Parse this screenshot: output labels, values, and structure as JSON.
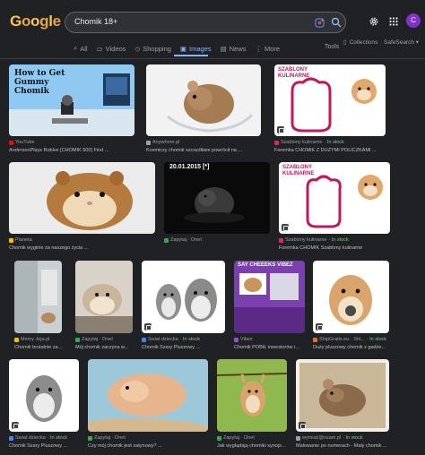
{
  "header": {
    "logo_letters": [
      "G",
      "o",
      "o",
      "g",
      "l",
      "e"
    ],
    "logo_colors": [
      "#f2c94c",
      "#e8a33d",
      "#f2c94c",
      "#e8a33d",
      "#f2c94c",
      "#e8a33d"
    ],
    "search_value": "Chomik 18+",
    "avatar_letter": "C"
  },
  "tabs": {
    "all": "All",
    "videos": "Videos",
    "shopping": "Shopping",
    "images": "Images",
    "news": "News",
    "more": "More",
    "tools": "Tools",
    "collections": "Collections",
    "safesearch": "SafeSearch ▾"
  },
  "colors": {
    "accent": "#8ab4f8",
    "in_stock": "#81c995",
    "background": "#202124"
  },
  "results": [
    {
      "source": "YouTube",
      "in_stock": "",
      "caption": "AndersonPlays Roblox [CHOMIK 500] Find ...",
      "overlay": "How to Get Gummy Chomik",
      "fav": "#ff0000"
    },
    {
      "source": "Anywhere.pl",
      "in_stock": "",
      "caption": "Kosmiczy chomik szczęśliwie powrócił na ...",
      "overlay": "",
      "fav": "#9aa0a6"
    },
    {
      "source": "Szablony kulinarne",
      "in_stock": "· In stock",
      "caption": "Foremka CHOMIK Z DUŻYMI POLICZKAMI ...",
      "overlay": "SZABLONY KULINARNE",
      "fav": "#e91e63"
    },
    {
      "source": "Planeta",
      "in_stock": "",
      "caption": "Chomik wyginie za naszego życia ...",
      "overlay": "",
      "fav": "#fbbc04"
    },
    {
      "source": "Zapytaj · Onet",
      "in_stock": "",
      "caption": "",
      "overlay": "20.01.2015 [*]",
      "fav": "#34a853"
    },
    {
      "source": "Szablony kulinarne",
      "in_stock": "· In stock",
      "caption": "Foremka CHOMIK Szablony kulinarne",
      "overlay": "SZABLONY KULINARNE",
      "fav": "#e91e63"
    },
    {
      "source": "Memy Jeja.pl",
      "in_stock": "",
      "caption": "Chomik brutalnie zamo...",
      "overlay": "",
      "fav": "#fbbc04"
    },
    {
      "source": "Zapytaj · Onet",
      "in_stock": "",
      "caption": "Mój chomik zaczyna w...",
      "overlay": "",
      "fav": "#34a853"
    },
    {
      "source": "Świat dziecka",
      "in_stock": "· In stock",
      "caption": "Chomik Szary Pluszowy ...",
      "overlay": "",
      "fav": "#4285f4"
    },
    {
      "source": "Vibez",
      "in_stock": "",
      "caption": "Chomik POBIŁ inwestorów i...",
      "overlay": "SAY CHEEEKS VIBEZ",
      "fav": "#a142f4"
    },
    {
      "source": "ShipGratis.eu · Shi...",
      "in_stock": "· In stock",
      "caption": "Duży pluszowy chomik z gadże...",
      "overlay": "",
      "fav": "#ff6d00"
    },
    {
      "source": "Świat dziecka",
      "in_stock": "· In stock",
      "caption": "Chomik Szary Pluszowy ...",
      "overlay": "",
      "fav": "#4285f4"
    },
    {
      "source": "Zapytaj · Onet",
      "in_stock": "",
      "caption": "Czy mój chomik jest zatynowy? ...",
      "overlay": "",
      "fav": "#34a853"
    },
    {
      "source": "Zapytaj · Onet",
      "in_stock": "",
      "caption": "Jak wyglądają chomiki synojskie ...",
      "overlay": "",
      "fav": "#34a853"
    },
    {
      "source": "wymiaż@osam.pl",
      "in_stock": "· In stock",
      "caption": "Malowanie po numerach - Mały chomik ...",
      "overlay": "",
      "fav": "#9aa0a6"
    }
  ]
}
